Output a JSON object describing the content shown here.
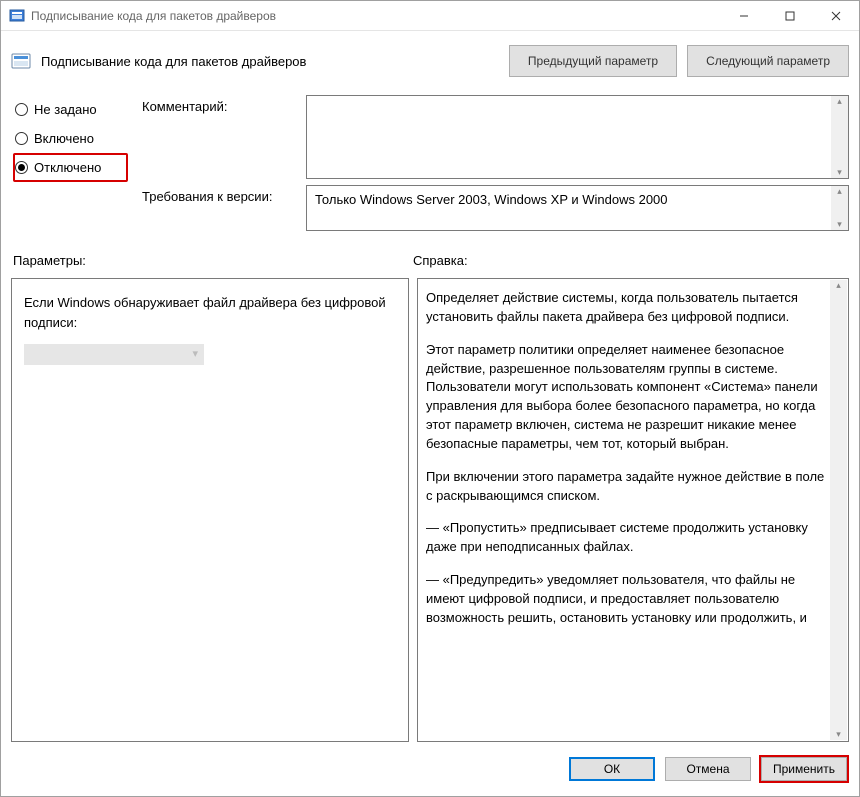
{
  "window": {
    "title": "Подписывание кода для пакетов драйверов"
  },
  "header": {
    "title": "Подписывание кода для пакетов драйверов",
    "prev_btn": "Предыдущий параметр",
    "next_btn": "Следующий параметр"
  },
  "radios": {
    "not_configured": "Не задано",
    "enabled": "Включено",
    "disabled": "Отключено"
  },
  "labels": {
    "comment": "Комментарий:",
    "version_req": "Требования к версии:",
    "parameters": "Параметры:",
    "help": "Справка:"
  },
  "version_text": "Только Windows Server 2003, Windows XP и Windows 2000",
  "params": {
    "text": "Если Windows обнаруживает файл драйвера без цифровой подписи:"
  },
  "help": {
    "p1": "Определяет действие системы, когда пользователь пытается установить файлы пакета драйвера без цифровой подписи.",
    "p2": "Этот параметр политики определяет наименее безопасное действие, разрешенное пользователям группы в системе. Пользователи могут использовать компонент «Система» панели управления для выбора более безопасного параметра, но когда этот параметр включен, система не разрешит никакие менее безопасные параметры, чем тот, который выбран.",
    "p3": "При включении этого параметра задайте нужное действие в поле с раскрывающимся списком.",
    "p4": "—   «Пропустить» предписывает системе продолжить установку даже при неподписанных файлах.",
    "p5": "—   «Предупредить» уведомляет пользователя, что файлы не имеют цифровой подписи, и предоставляет пользователю возможность решить, остановить установку или продолжить, и"
  },
  "footer": {
    "ok": "ОК",
    "cancel": "Отмена",
    "apply": "Применить"
  }
}
